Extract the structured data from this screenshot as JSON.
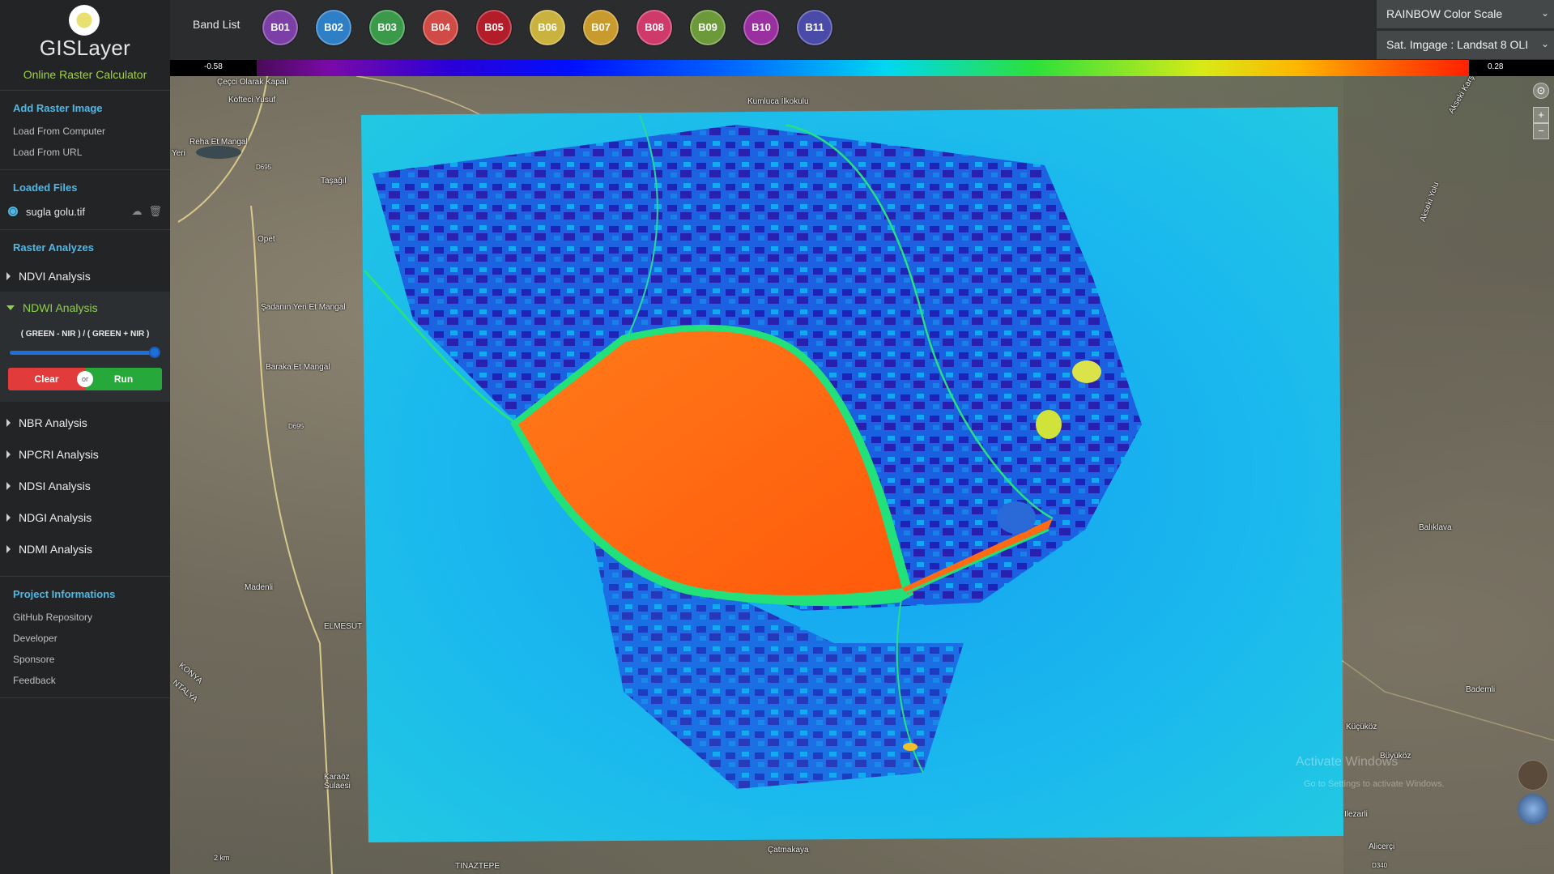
{
  "app": {
    "name": "GISLayer",
    "subtitle": "Online Raster Calculator"
  },
  "sidebar": {
    "add_raster": {
      "title": "Add Raster Image",
      "items": [
        "Load From Computer",
        "Load From URL"
      ]
    },
    "loaded_files": {
      "title": "Loaded Files",
      "files": [
        {
          "name": "sugla golu.tif"
        }
      ],
      "icons": [
        "cloud-download-icon",
        "trash-icon"
      ]
    },
    "raster_analyses": {
      "title": "Raster Analyzes",
      "items": [
        {
          "label": "NDVI Analysis"
        },
        {
          "label": "NDWI Analysis",
          "formula": "( GREEN - NIR ) / ( GREEN + NIR )",
          "slider_value": 1.0,
          "clear_label": "Clear",
          "or_label": "or",
          "run_label": "Run"
        },
        {
          "label": "NBR Analysis"
        },
        {
          "label": "NPCRI Analysis"
        },
        {
          "label": "NDSI Analysis"
        },
        {
          "label": "NDGI Analysis"
        },
        {
          "label": "NDMI Analysis"
        }
      ]
    },
    "project": {
      "title": "Project Informations",
      "items": [
        "GitHub Repository",
        "Developer",
        "Sponsore",
        "Feedback"
      ]
    }
  },
  "topbar": {
    "band_list_label": "Band List",
    "bands": [
      {
        "label": "B01",
        "color": "#7b3fa6"
      },
      {
        "label": "B02",
        "color": "#2f7fc6"
      },
      {
        "label": "B03",
        "color": "#3a9a4a"
      },
      {
        "label": "B04",
        "color": "#d04b46"
      },
      {
        "label": "B05",
        "color": "#b31d2a"
      },
      {
        "label": "B06",
        "color": "#c9b23e"
      },
      {
        "label": "B07",
        "color": "#c99a2e"
      },
      {
        "label": "B08",
        "color": "#cf3a6a"
      },
      {
        "label": "B09",
        "color": "#6c9a3a"
      },
      {
        "label": "B10",
        "color": "#9a2fa0"
      },
      {
        "label": "B11",
        "color": "#4a4aa8"
      }
    ],
    "color_scale": "RAINBOW Color Scale",
    "sat_image": "Sat. Imgage : Landsat 8 OLI"
  },
  "scale": {
    "min": "-0.58",
    "max": "0.28"
  },
  "map": {
    "places": [
      "Çeçci Olarak Kapalı",
      "Kofteci Yusuf",
      "Kumluca İlkokulu",
      "Reha Et Mangal",
      "Yeri",
      "D695",
      "Taşağıl",
      "Opet",
      "Şadanın Yeri Et Mangal",
      "Baraka Et Mangal",
      "D695",
      "Madenli",
      "ELMESUT",
      "KONYA",
      "NTALYA",
      "Karaöz Sulaesi",
      "TINAZTEPE",
      "Çatmakaya",
      "Balıklava",
      "Bademli",
      "Küçüköz",
      "Büyüköz",
      "Ilezarli",
      "Alicerçi",
      "D340",
      "Akseki Karşı",
      "Akseki Yolu",
      "Activate Windows",
      "Go to Settings to activate Windows.",
      "2 km"
    ],
    "controls": [
      "compass-icon",
      "zoom-in-button",
      "zoom-out-button"
    ]
  }
}
